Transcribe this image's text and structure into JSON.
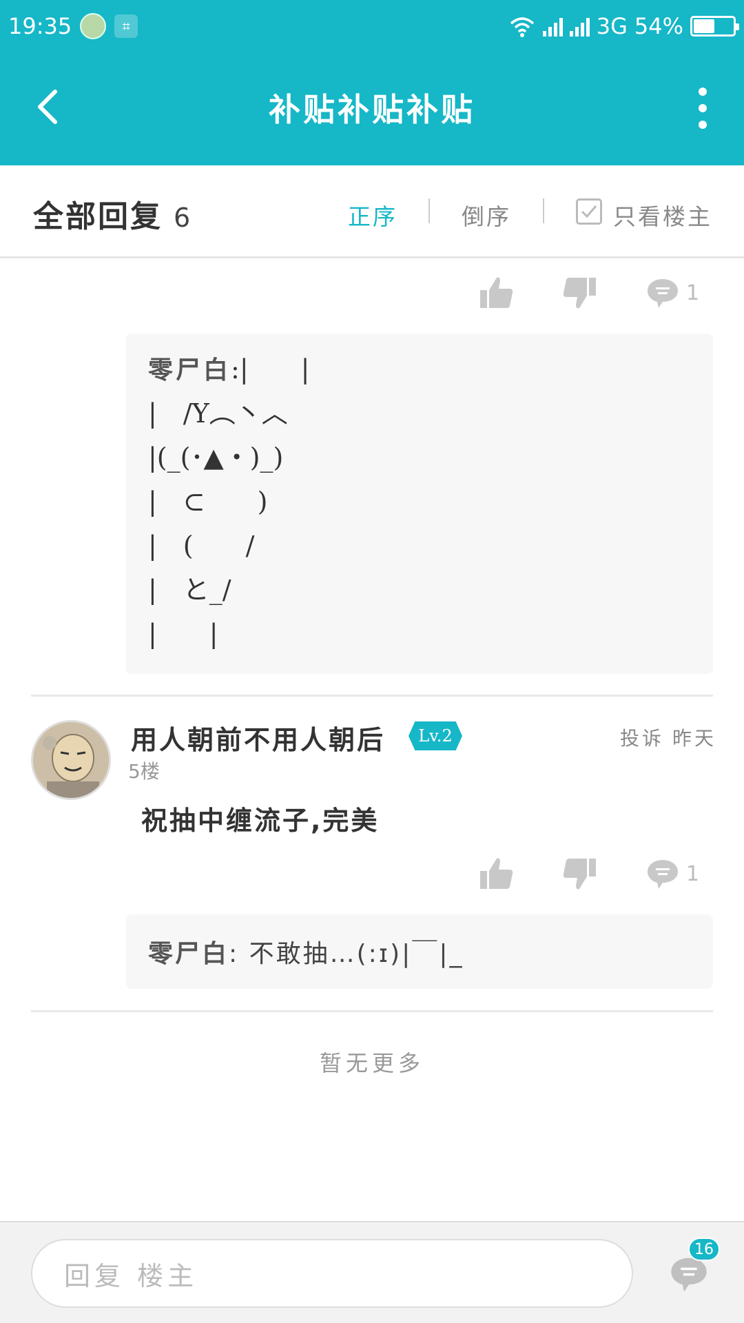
{
  "status_bar": {
    "time": "19:35",
    "network": "3G",
    "battery": "54%",
    "battery_level": 0.54
  },
  "app_bar": {
    "title": "补贴补贴补贴",
    "back_icon": "back-arrow-icon",
    "more_icon": "more-vertical-icon"
  },
  "filter": {
    "all_replies_label": "全部回复",
    "reply_count": "6",
    "sort_asc": "正序",
    "sort_desc": "倒序",
    "only_op_label": "只看楼主",
    "active_color": "#16b7c7"
  },
  "post_prev": {
    "reply_count": "1",
    "quote": {
      "name": "零尸白",
      "lines": [
        ":|　　|",
        "|　/Y︵丶︿",
        "|(_(･▲・)_)",
        "|　⊂　　)",
        "|　(　　/",
        "|　と_/",
        "|　　|"
      ]
    }
  },
  "post": {
    "username": "用人朝前不用人朝后",
    "level": "Lv.2",
    "floor": "5楼",
    "report": "投诉",
    "time": "昨天",
    "content": "祝抽中缠流子,完美",
    "reply_count": "1",
    "quote": {
      "name": "零尸白",
      "text": ": 不敢抽…(:ɪ)|￣|_"
    }
  },
  "no_more": "暂无更多",
  "bottom": {
    "placeholder": "回复  楼主",
    "badge": "16"
  }
}
